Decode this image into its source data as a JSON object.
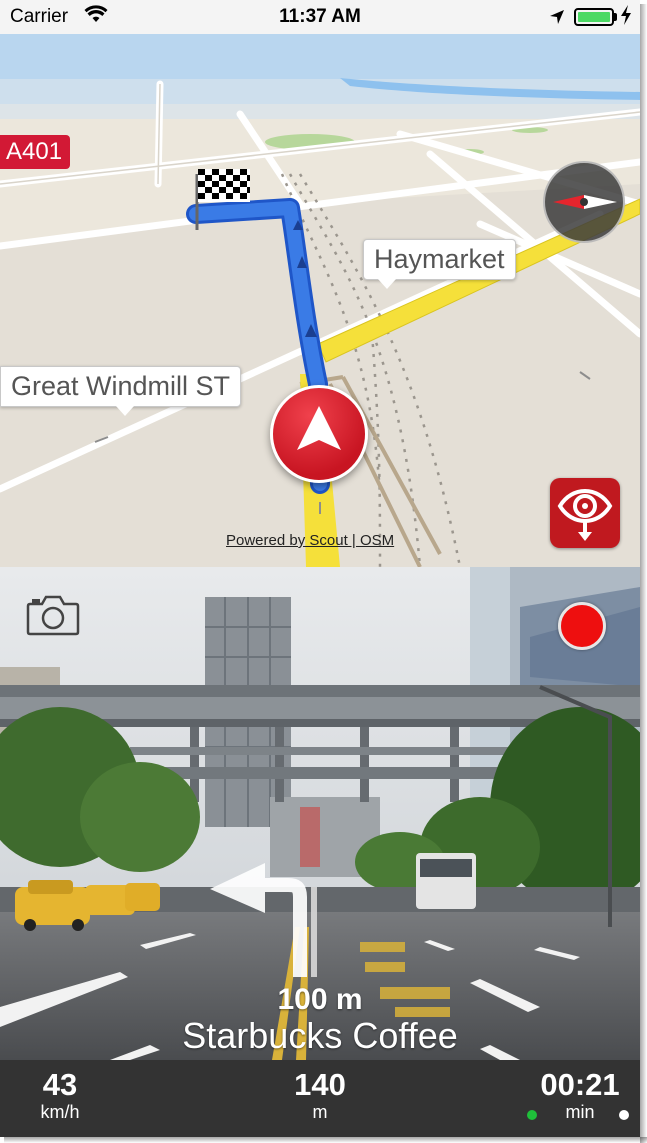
{
  "status_bar": {
    "carrier": "Carrier",
    "time": "11:37 AM",
    "wifi_icon": "wifi-icon",
    "location_icon": "location-arrow-icon",
    "battery_icon": "battery-icon",
    "battery_color": "#4cd964"
  },
  "map": {
    "road_shield": "A401",
    "labels": {
      "haymarket": "Haymarket",
      "great_windmill": "Great Windmill ST"
    },
    "attribution": "Powered by Scout | OSM",
    "compass_icon": "compass-icon",
    "destination_icon": "checkered-flag-icon",
    "position_icon": "navigation-arrow-icon",
    "view_toggle_icon": "eye-icon",
    "route_color": "#3a7be6",
    "accent_color": "#d21935"
  },
  "camera_view": {
    "snapshot_icon": "camera-icon",
    "record_icon": "record-icon",
    "turn_icon": "turn-left-arrow-icon",
    "turn_distance": "100 m",
    "turn_street": "Starbucks Coffee"
  },
  "info_bar": {
    "speed_value": "43",
    "speed_unit": "km/h",
    "distance_value": "140",
    "distance_unit": "m",
    "time_value": "00:21",
    "time_unit": "min"
  }
}
